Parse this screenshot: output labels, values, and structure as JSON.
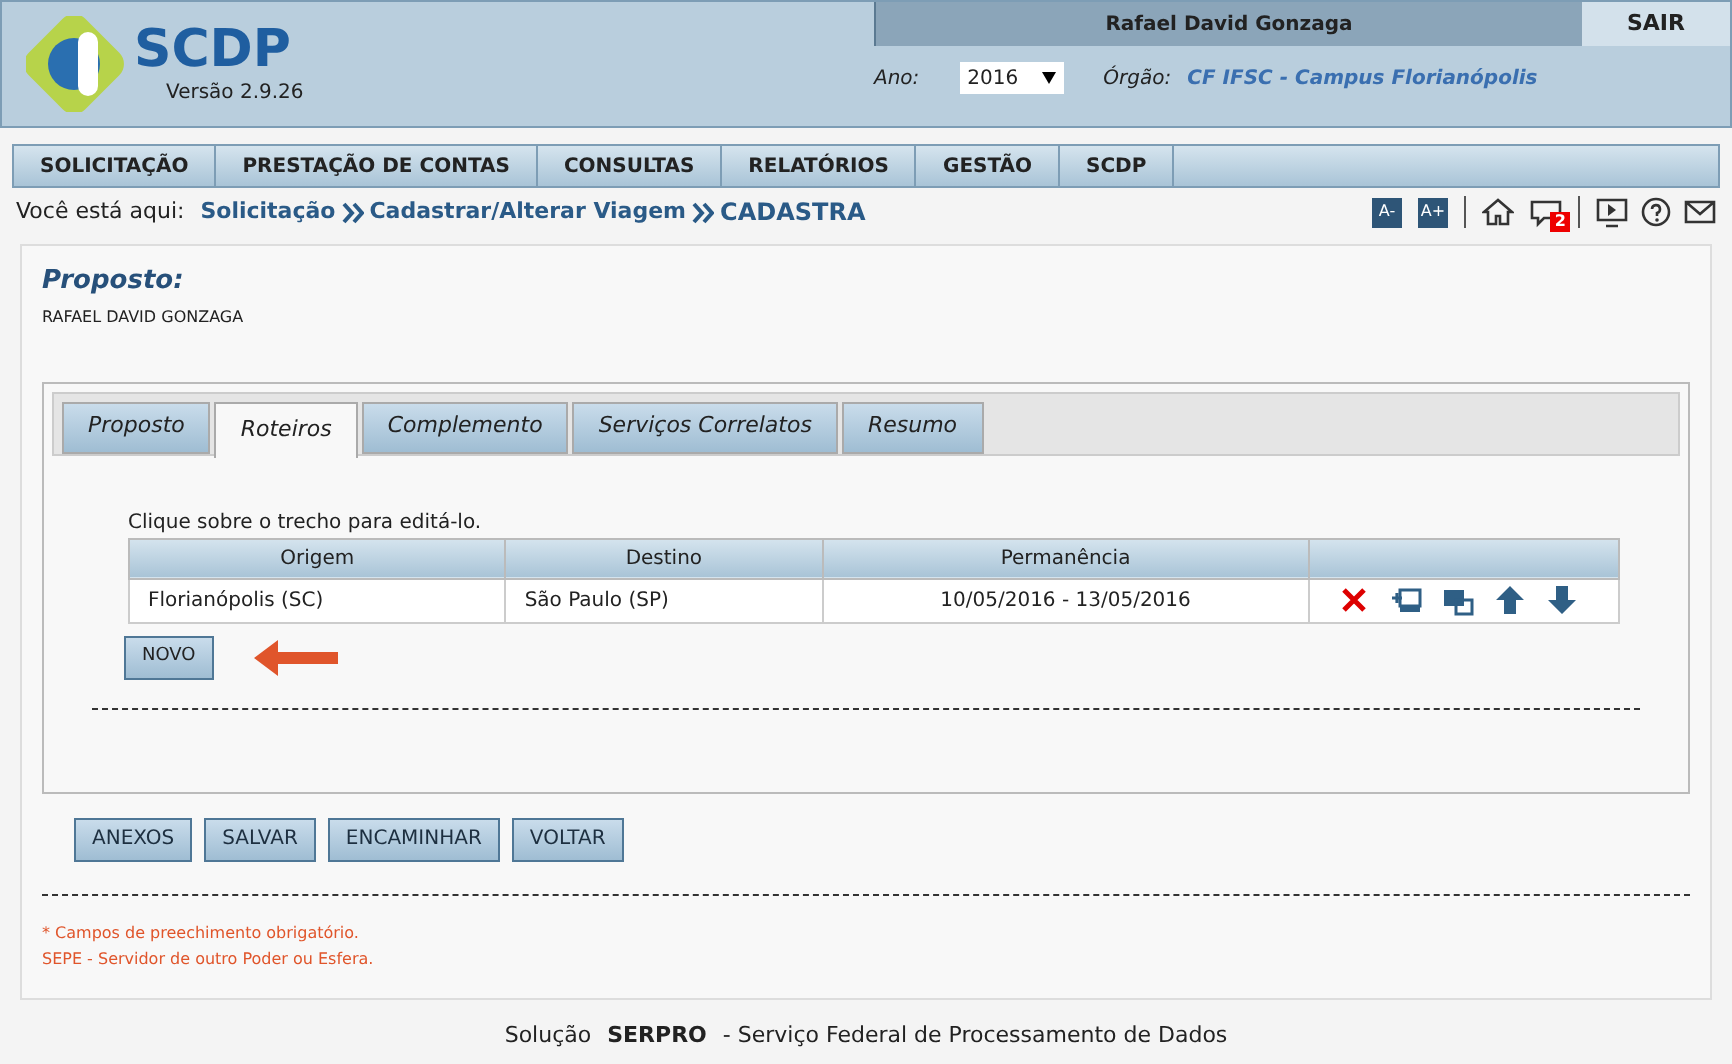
{
  "header": {
    "logo_text": "SCDP",
    "version": "Versão 2.9.26",
    "user": "Rafael David Gonzaga",
    "logout": "SAIR",
    "year_label": "Ano:",
    "year": "2016",
    "org_label": "Órgão:",
    "org": "CF IFSC - Campus Florianópolis"
  },
  "menu": [
    {
      "label": "SOLICITAÇÃO"
    },
    {
      "label": "PRESTAÇÃO DE CONTAS"
    },
    {
      "label": "CONSULTAS"
    },
    {
      "label": "RELATÓRIOS"
    },
    {
      "label": "GESTÃO"
    },
    {
      "label": "SCDP"
    }
  ],
  "breadcrumb": {
    "prefix": "Você está aqui:",
    "items": [
      "Solicitação",
      "Cadastrar/Alterar Viagem"
    ],
    "current": "CADASTRA"
  },
  "toolbar": {
    "font_smaller": "A-",
    "font_larger": "A+",
    "message_count": "2"
  },
  "proposto": {
    "title": "Proposto:",
    "name": "RAFAEL DAVID GONZAGA"
  },
  "tabs": [
    {
      "label": "Proposto",
      "selected": false
    },
    {
      "label": "Roteiros",
      "selected": true
    },
    {
      "label": "Complemento",
      "selected": false
    },
    {
      "label": "Serviços Correlatos",
      "selected": false
    },
    {
      "label": "Resumo",
      "selected": false
    }
  ],
  "hint": "Clique sobre o trecho para editá-lo.",
  "table": {
    "columns": [
      "Origem",
      "Destino",
      "Permanência"
    ],
    "rows": [
      {
        "cells": [
          "Florianópolis (SC)",
          "São Paulo (SP)",
          "10/05/2016 - 13/05/2016"
        ]
      }
    ]
  },
  "new_button": "NOVO",
  "buttons": [
    "ANEXOS",
    "SALVAR",
    "ENCAMINHAR",
    "VOLTAR"
  ],
  "notes": [
    "* Campos de preechimento obrigatório.",
    "SEPE - Servidor de outro Poder ou Esfera."
  ],
  "footer": {
    "prefix": "Solução",
    "brand": "SERPRO",
    "suffix": "- Serviço Federal de Processamento de Dados"
  }
}
